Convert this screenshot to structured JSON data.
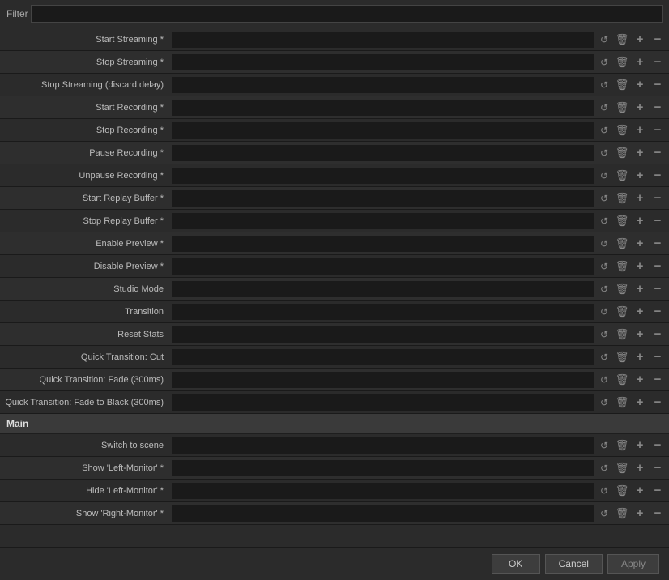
{
  "filter": {
    "label": "Filter",
    "placeholder": ""
  },
  "hotkeys": [
    {
      "id": "start-streaming",
      "label": "Start Streaming *"
    },
    {
      "id": "stop-streaming",
      "label": "Stop Streaming *"
    },
    {
      "id": "stop-streaming-discard",
      "label": "Stop Streaming (discard delay)"
    },
    {
      "id": "start-recording",
      "label": "Start Recording *"
    },
    {
      "id": "stop-recording",
      "label": "Stop Recording *"
    },
    {
      "id": "pause-recording",
      "label": "Pause Recording *"
    },
    {
      "id": "unpause-recording",
      "label": "Unpause Recording *"
    },
    {
      "id": "start-replay-buffer",
      "label": "Start Replay Buffer *"
    },
    {
      "id": "stop-replay-buffer",
      "label": "Stop Replay Buffer *"
    },
    {
      "id": "enable-preview",
      "label": "Enable Preview *"
    },
    {
      "id": "disable-preview",
      "label": "Disable Preview *"
    },
    {
      "id": "studio-mode",
      "label": "Studio Mode"
    },
    {
      "id": "transition",
      "label": "Transition"
    },
    {
      "id": "reset-stats",
      "label": "Reset Stats"
    },
    {
      "id": "quick-transition-cut",
      "label": "Quick Transition: Cut"
    },
    {
      "id": "quick-transition-fade",
      "label": "Quick Transition: Fade (300ms)"
    },
    {
      "id": "quick-transition-fade-black",
      "label": "Quick Transition: Fade to Black (300ms)"
    }
  ],
  "main_section": {
    "label": "Main",
    "items": [
      {
        "id": "switch-to-scene",
        "label": "Switch to scene"
      },
      {
        "id": "show-left-monitor",
        "label": "Show 'Left-Monitor' *"
      },
      {
        "id": "hide-left-monitor",
        "label": "Hide 'Left-Monitor' *"
      },
      {
        "id": "show-right-monitor",
        "label": "Show 'Right-Monitor' *"
      }
    ]
  },
  "footer": {
    "ok_label": "OK",
    "cancel_label": "Cancel",
    "apply_label": "Apply"
  }
}
